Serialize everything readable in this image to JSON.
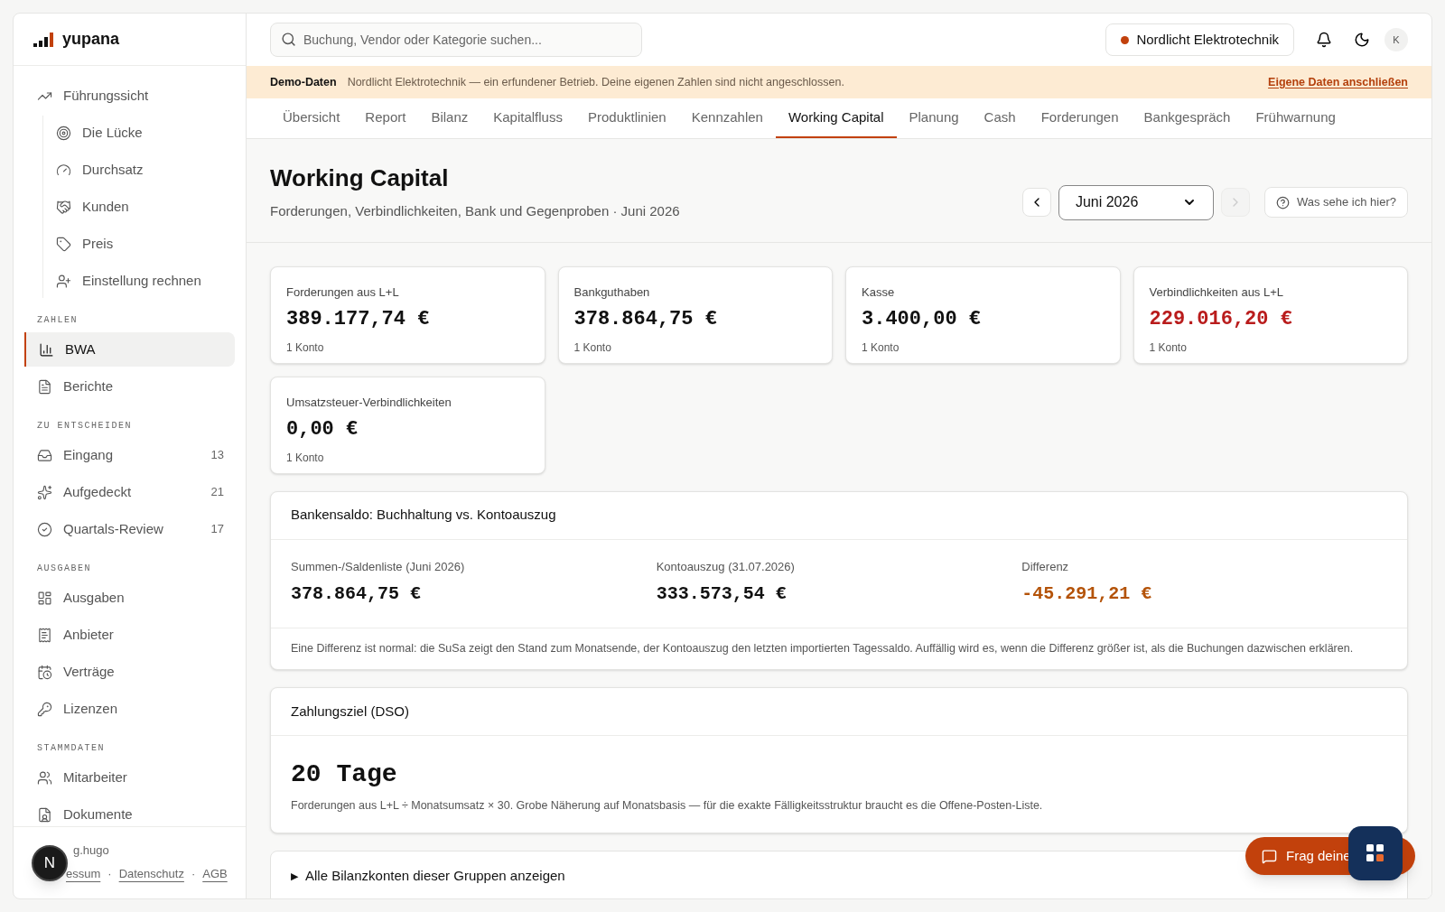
{
  "sidebar": {
    "logo": "yupana",
    "groups": [
      {
        "items": [
          {
            "label": "Führungssicht",
            "selected": false,
            "children": [
              {
                "label": "Die Lücke",
                "selected": false
              },
              {
                "label": "Durchsatz",
                "selected": false
              },
              {
                "label": "Kunden",
                "selected": false
              },
              {
                "label": "Preis",
                "selected": false
              },
              {
                "label": "Einstellung rechnen",
                "selected": false
              }
            ]
          }
        ]
      },
      {
        "heading": "ZAHLEN",
        "items": [
          {
            "label": "BWA",
            "selected": true
          },
          {
            "label": "Berichte",
            "selected": false
          }
        ]
      },
      {
        "heading": "ZU ENTSCHEIDEN",
        "items": [
          {
            "label": "Eingang",
            "selected": false,
            "count": "13"
          },
          {
            "label": "Aufgedeckt",
            "selected": false,
            "count": "21"
          },
          {
            "label": "Quartals-Review",
            "selected": false,
            "count": "17"
          }
        ]
      },
      {
        "heading": "AUSGABEN",
        "items": [
          {
            "label": "Ausgaben",
            "selected": false
          },
          {
            "label": "Anbieter",
            "selected": false
          },
          {
            "label": "Verträge",
            "selected": false
          },
          {
            "label": "Lizenzen",
            "selected": false
          }
        ]
      },
      {
        "heading": "STAMMDATEN",
        "items": [
          {
            "label": "Mitarbeiter",
            "selected": false
          },
          {
            "label": "Dokumente",
            "selected": false
          }
        ]
      }
    ],
    "footer": {
      "credit": "g.hugo",
      "links": [
        "essum",
        "Datenschutz",
        "AGB"
      ],
      "separator": "·"
    }
  },
  "header": {
    "search": {
      "placeholder": "Buchung, Vendor oder Kategorie suchen..."
    },
    "company": {
      "name": "Nordlicht Elektrotechnik",
      "color": "#c2410c"
    },
    "avatar": "K"
  },
  "banner": {
    "label": "Demo-Daten",
    "text": "Nordlicht Elektrotechnik — ein erfundener Betrieb. Deine eigenen Zahlen sind nicht angeschlossen.",
    "link": "Eigene Daten anschließen"
  },
  "tabs": [
    {
      "label": "Übersicht",
      "selected": false
    },
    {
      "label": "Report",
      "selected": false
    },
    {
      "label": "Bilanz",
      "selected": false
    },
    {
      "label": "Kapitalfluss",
      "selected": false
    },
    {
      "label": "Produktlinien",
      "selected": false
    },
    {
      "label": "Kennzahlen",
      "selected": false
    },
    {
      "label": "Working Capital",
      "selected": true
    },
    {
      "label": "Planung",
      "selected": false
    },
    {
      "label": "Cash",
      "selected": false
    },
    {
      "label": "Forderungen",
      "selected": false
    },
    {
      "label": "Bankgespräch",
      "selected": false
    },
    {
      "label": "Frühwarnung",
      "selected": false
    }
  ],
  "page": {
    "title": "Working Capital",
    "subtitle": "Forderungen, Verbindlichkeiten, Bank und Gegenproben · Juni 2026",
    "period": "Juni 2026",
    "next_disabled": true,
    "help": "Was sehe ich hier?"
  },
  "cards": [
    {
      "label": "Forderungen aus L+L",
      "value": "389.177,74 €",
      "note": "1 Konto",
      "negative": false
    },
    {
      "label": "Bankguthaben",
      "value": "378.864,75 €",
      "note": "1 Konto",
      "negative": false
    },
    {
      "label": "Kasse",
      "value": "3.400,00 €",
      "note": "1 Konto",
      "negative": false
    },
    {
      "label": "Verbindlichkeiten aus L+L",
      "value": "229.016,20 €",
      "note": "1 Konto",
      "negative": true
    },
    {
      "label": "Umsatzsteuer-Verbindlichkeiten",
      "value": "0,00 €",
      "note": "1 Konto",
      "negative": false
    }
  ],
  "bank": {
    "title": "Bankensaldo: Buchhaltung vs. Kontoauszug",
    "columns": [
      {
        "label": "Summen-/Saldenliste (Juni 2026)",
        "value": "378.864,75 €",
        "warning": false
      },
      {
        "label": "Kontoauszug (31.07.2026)",
        "value": "333.573,54 €",
        "warning": false
      },
      {
        "label": "Differenz",
        "value": "-45.291,21 €",
        "warning": true
      }
    ],
    "note": "Eine Differenz ist normal: die SuSa zeigt den Stand zum Monatsende, der Kontoauszug den letzten importierten Tagessaldo. Auffällig wird es, wenn die Differenz größer ist, als die Buchungen dazwischen erklären."
  },
  "dso": {
    "title": "Zahlungsziel (DSO)",
    "value": "20 Tage",
    "note": "Forderungen aus L+L ÷ Monatsumsatz × 30. Grobe Näherung auf Monatsbasis — für die exakte Fälligkeitsstruktur braucht es die Offene-Posten-Liste."
  },
  "accounts": {
    "marker": "▶",
    "label": "Alle Bilanzkonten dieser Gruppen anzeigen",
    "expanded": false
  },
  "chat": {
    "label": "Frag deine"
  },
  "dev_badge": "N"
}
